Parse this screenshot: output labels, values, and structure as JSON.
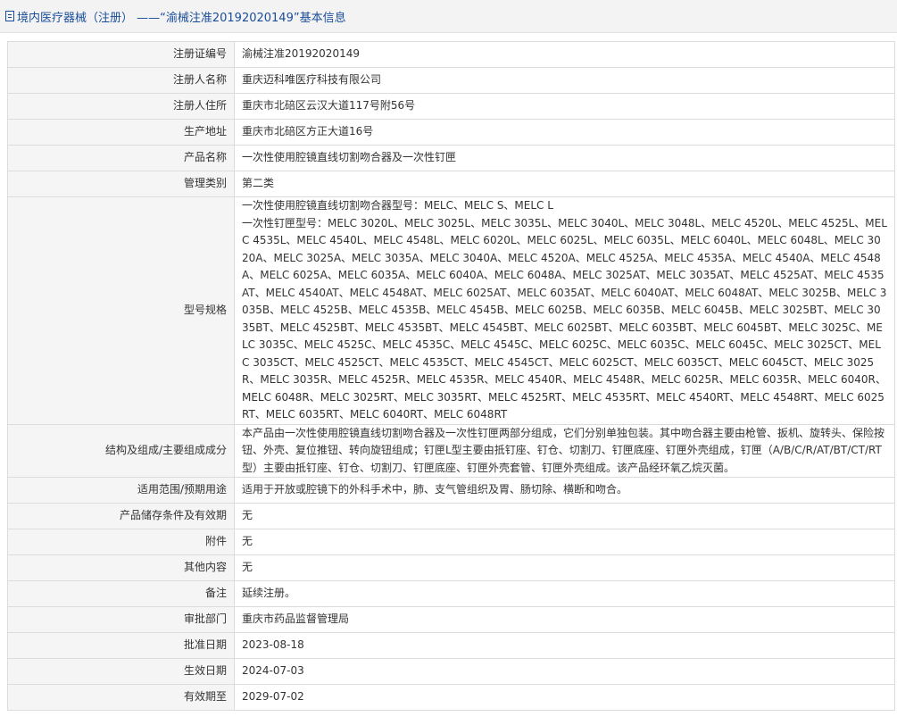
{
  "header": {
    "title": "境内医疗器械（注册） ——“渝械注准20192020149”基本信息"
  },
  "rows": [
    {
      "label": "注册证编号",
      "value": "渝械注准20192020149"
    },
    {
      "label": "注册人名称",
      "value": "重庆迈科唯医疗科技有限公司"
    },
    {
      "label": "注册人住所",
      "value": "重庆市北碚区云汉大道117号附56号"
    },
    {
      "label": "生产地址",
      "value": "重庆市北碚区方正大道16号"
    },
    {
      "label": "产品名称",
      "value": "一次性使用腔镜直线切割吻合器及一次性钉匣"
    },
    {
      "label": "管理类别",
      "value": "第二类"
    },
    {
      "label": "型号规格",
      "value_lines": [
        "一次性使用腔镜直线切割吻合器型号：MELC、MELC S、MELC L",
        "一次性钉匣型号：MELC 3020L、MELC 3025L、MELC 3035L、MELC 3040L、MELC 3048L、MELC 4520L、MELC 4525L、MELC 4535L、MELC 4540L、MELC 4548L、MELC 6020L、MELC 6025L、MELC 6035L、MELC 6040L、MELC 6048L、MELC 3020A、MELC 3025A、MELC 3035A、MELC 3040A、MELC 4520A、MELC 4525A、MELC 4535A、MELC 4540A、MELC 4548A、MELC 6025A、MELC 6035A、MELC 6040A、MELC 6048A、MELC 3025AT、MELC 3035AT、MELC 4525AT、MELC 4535AT、MELC 4540AT、MELC 4548AT、MELC 6025AT、MELC 6035AT、MELC 6040AT、MELC 6048AT、MELC 3025B、MELC 3035B、MELC 4525B、MELC 4535B、MELC 4545B、MELC 6025B、MELC 6035B、MELC 6045B、MELC 3025BT、MELC 3035BT、MELC 4525BT、MELC 4535BT、MELC 4545BT、MELC 6025BT、MELC 6035BT、MELC 6045BT、MELC 3025C、MELC 3035C、MELC 4525C、MELC 4535C、MELC 4545C、MELC 6025C、MELC 6035C、MELC 6045C、MELC 3025CT、MELC 3035CT、MELC 4525CT、MELC 4535CT、MELC 4545CT、MELC 6025CT、MELC 6035CT、MELC 6045CT、MELC 3025R、MELC 3035R、MELC 4525R、MELC 4535R、MELC 4540R、MELC 4548R、MELC 6025R、MELC 6035R、MELC 6040R、MELC 6048R、MELC 3025RT、MELC 3035RT、MELC 4525RT、MELC 4535RT、MELC 4540RT、MELC 4548RT、MELC 6025RT、MELC 6035RT、MELC 6040RT、MELC 6048RT"
      ]
    },
    {
      "label": "结构及组成/主要组成成分",
      "value": "本产品由一次性使用腔镜直线切割吻合器及一次性钉匣两部分组成，它们分别单独包装。其中吻合器主要由枪管、扳机、旋转头、保险按钮、外壳、复位推钮、转向旋钮组成；钉匣L型主要由抵钉座、钉仓、切割刀、钉匣底座、钉匣外壳组成，钉匣（A/B/C/R/AT/BT/CT/RT型）主要由抵钉座、钉仓、切割刀、钉匣底座、钉匣外壳套管、钉匣外壳组成。该产品经环氧乙烷灭菌。"
    },
    {
      "label": "适用范围/预期用途",
      "value": "适用于开放或腔镜下的外科手术中，肺、支气管组织及胃、肠切除、横断和吻合。"
    },
    {
      "label": "产品储存条件及有效期",
      "value": "无"
    },
    {
      "label": "附件",
      "value": "无"
    },
    {
      "label": "其他内容",
      "value": "无"
    },
    {
      "label": "备注",
      "value": "延续注册。"
    },
    {
      "label": "审批部门",
      "value": "重庆市药品监督管理局"
    },
    {
      "label": "批准日期",
      "value": "2023-08-18"
    },
    {
      "label": "生效日期",
      "value": "2024-07-03"
    },
    {
      "label": "有效期至",
      "value": "2029-07-02"
    }
  ]
}
